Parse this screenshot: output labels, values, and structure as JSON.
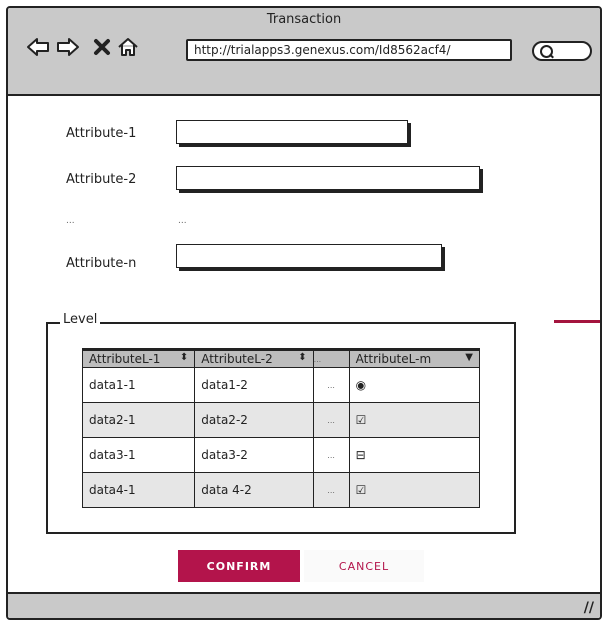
{
  "window": {
    "title": "Transaction"
  },
  "browser": {
    "back_icon": "back-arrow-icon",
    "forward_icon": "forward-arrow-icon",
    "stop_icon": "close-icon",
    "home_icon": "home-icon",
    "url": "http://trialapps3.genexus.com/Id8562acf4/",
    "search_icon": "search-icon"
  },
  "form": {
    "fields": [
      {
        "label": "Attribute-1",
        "value": ""
      },
      {
        "label": "Attribute-2",
        "value": ""
      },
      {
        "label": "Attribute-n",
        "value": ""
      }
    ],
    "ellipsis_left": "...",
    "ellipsis_right": "..."
  },
  "level": {
    "title": "Level",
    "columns": [
      "AttributeL-1",
      "AttributeL-2",
      "...",
      "AttributeL-m"
    ],
    "rows": [
      {
        "c1": "data1-1",
        "c2": "data1-2",
        "c3": "...",
        "c4": "◉"
      },
      {
        "c1": "data2-1",
        "c2": "data2-2",
        "c3": "...",
        "c4": "☑"
      },
      {
        "c1": "data3-1",
        "c2": "data3-2",
        "c3": "...",
        "c4": "⊟"
      },
      {
        "c1": "data4-1",
        "c2": "data 4-2",
        "c3": "...",
        "c4": "☑"
      }
    ]
  },
  "actions": {
    "confirm": "CONFIRM",
    "cancel": "CANCEL"
  },
  "colors": {
    "accent": "#b3144b",
    "chrome": "#c9c9c9"
  }
}
